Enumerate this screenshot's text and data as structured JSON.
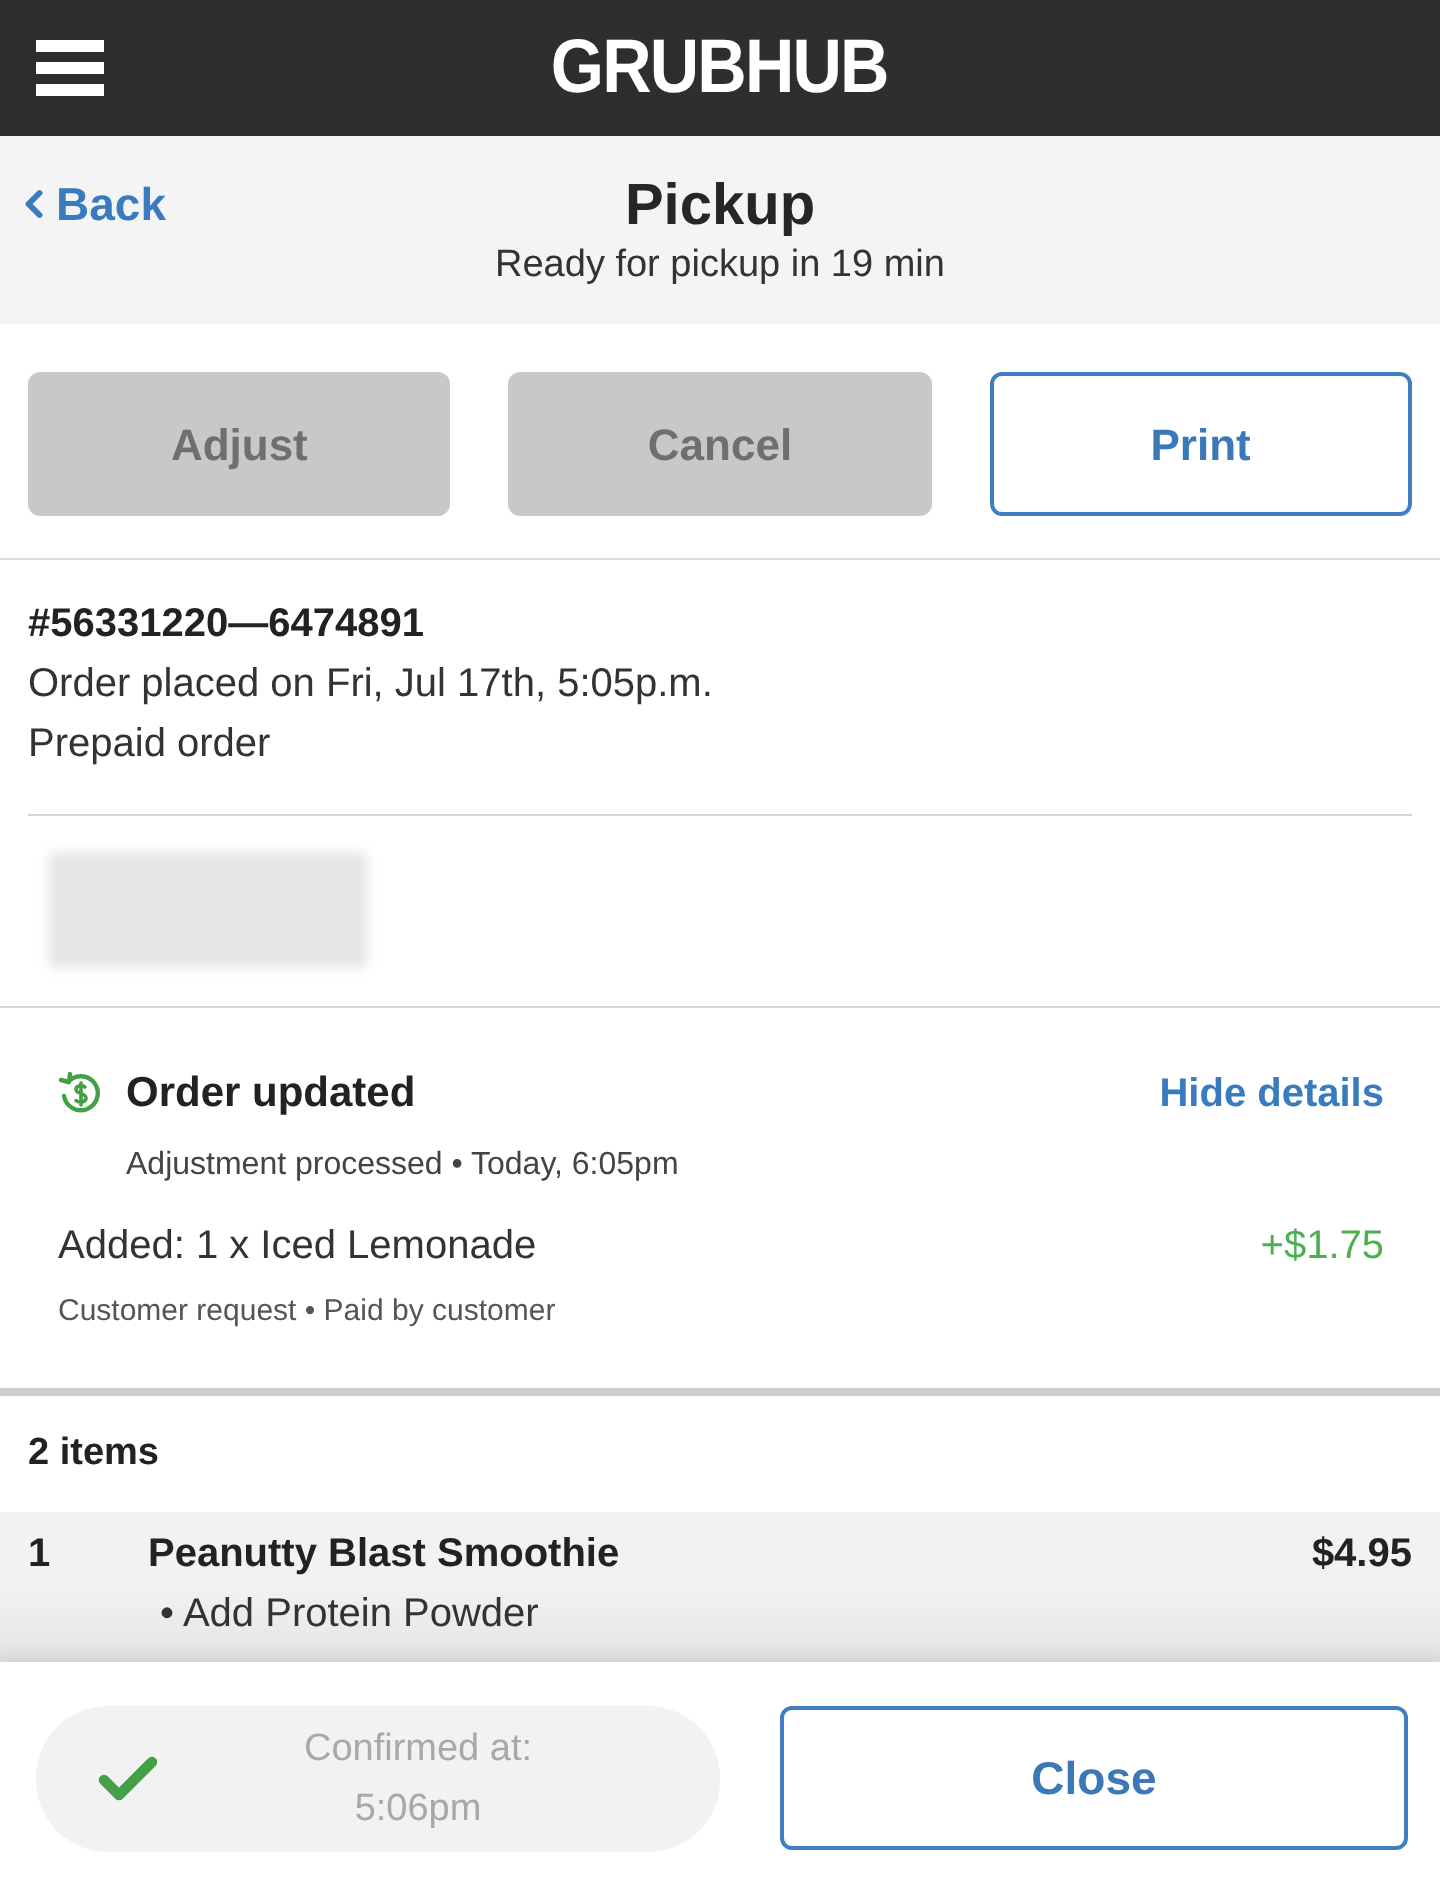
{
  "header": {
    "logo": "GRUBHUB"
  },
  "nav": {
    "back": "Back",
    "title": "Pickup",
    "subtitle": "Ready for pickup in 19 min"
  },
  "actions": [
    {
      "label": "Adjust",
      "disabled": true
    },
    {
      "label": "Cancel",
      "disabled": true
    },
    {
      "label": "Print",
      "disabled": false
    }
  ],
  "order": {
    "number": "#56331220—6474891",
    "placed": "Order placed on Fri, Jul 17th, 5:05p.m.",
    "payment": "Prepaid order"
  },
  "update": {
    "title": "Order updated",
    "toggle": "Hide details",
    "meta": "Adjustment processed • Today, 6:05pm",
    "changes": [
      {
        "description": "Added: 1 x Iced Lemonade",
        "amount": "+$1.75",
        "note": "Customer request • Paid by customer"
      }
    ]
  },
  "items": {
    "count": "2 items",
    "rows": [
      {
        "quantity": "1",
        "name": "Peanutty Blast Smoothie",
        "price": "$4.95",
        "modifiers": [
          "• Add Protein Powder"
        ]
      }
    ]
  },
  "footer": {
    "confirmed": true,
    "status_label": "Confirmed at:",
    "status_time": "5:06pm",
    "close": "Close"
  }
}
